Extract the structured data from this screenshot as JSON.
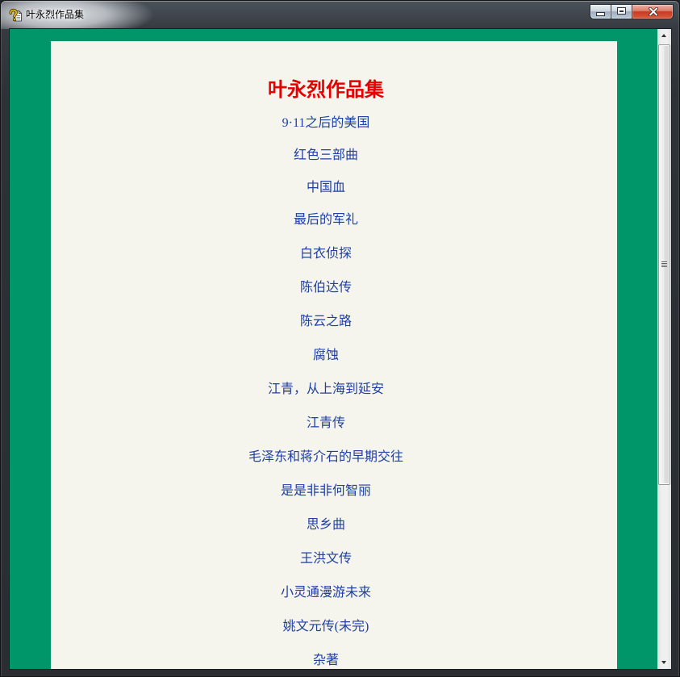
{
  "window": {
    "title": "叶永烈作品集",
    "icons": {
      "app": "help-file-icon",
      "minimize": "minimize-icon",
      "maximize": "maximize-icon",
      "close": "close-icon"
    }
  },
  "page": {
    "heading": "叶永烈作品集",
    "links": [
      "9·11之后的美国",
      "红色三部曲",
      "中国血",
      "最后的军礼",
      "白衣侦探",
      "陈伯达传",
      "陈云之路",
      "腐蚀",
      "江青，从上海到延安",
      "江青传",
      "毛泽东和蒋介石的早期交往",
      "是是非非何智丽",
      "思乡曲",
      "王洪文传",
      "小灵通漫游未来",
      "姚文元传(未完)",
      "杂著"
    ]
  },
  "colors": {
    "page_background": "#00966a",
    "content_background": "#f5f5ed",
    "heading": "#e60000",
    "link": "#1f3fa3"
  }
}
